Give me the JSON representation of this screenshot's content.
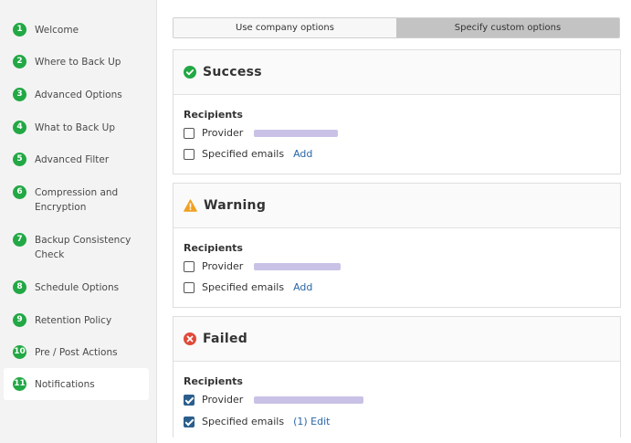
{
  "sidebar": {
    "steps": [
      {
        "num": "1",
        "label": "Welcome"
      },
      {
        "num": "2",
        "label": "Where to Back Up"
      },
      {
        "num": "3",
        "label": "Advanced Options"
      },
      {
        "num": "4",
        "label": "What to Back Up"
      },
      {
        "num": "5",
        "label": "Advanced Filter"
      },
      {
        "num": "6",
        "label": "Compression and Encryption"
      },
      {
        "num": "7",
        "label": "Backup Consistency Check"
      },
      {
        "num": "8",
        "label": "Schedule Options"
      },
      {
        "num": "9",
        "label": "Retention Policy"
      },
      {
        "num": "10",
        "label": "Pre / Post Actions"
      },
      {
        "num": "11",
        "label": "Notifications"
      }
    ],
    "active_step": "Notifications",
    "step_color": "#22a845"
  },
  "options_toggle": {
    "company": "Use company options",
    "custom": "Specify custom options",
    "selected": "Specify custom options"
  },
  "cards": {
    "success": {
      "title": "Success",
      "icon": "check-circle-icon",
      "color": "#22a845",
      "recipients_label": "Recipients",
      "provider_label": "Provider",
      "provider_checked": false,
      "emails_label": "Specified emails",
      "emails_action": "Add",
      "emails_checked": false
    },
    "warning": {
      "title": "Warning",
      "icon": "warning-triangle-icon",
      "color": "#f0a020",
      "recipients_label": "Recipients",
      "provider_label": "Provider",
      "provider_checked": false,
      "emails_label": "Specified emails",
      "emails_action": "Add",
      "emails_checked": false
    },
    "failed": {
      "title": "Failed",
      "icon": "error-circle-icon",
      "color": "#e04a3a",
      "recipients_label": "Recipients",
      "provider_label": "Provider",
      "provider_checked": true,
      "emails_label": "Specified emails",
      "emails_action": "(1) Edit",
      "emails_checked": true
    }
  },
  "colors": {
    "link": "#2a66a8",
    "checkbox_checked": "#2a5e8c",
    "redaction": "#c9c2e6"
  }
}
